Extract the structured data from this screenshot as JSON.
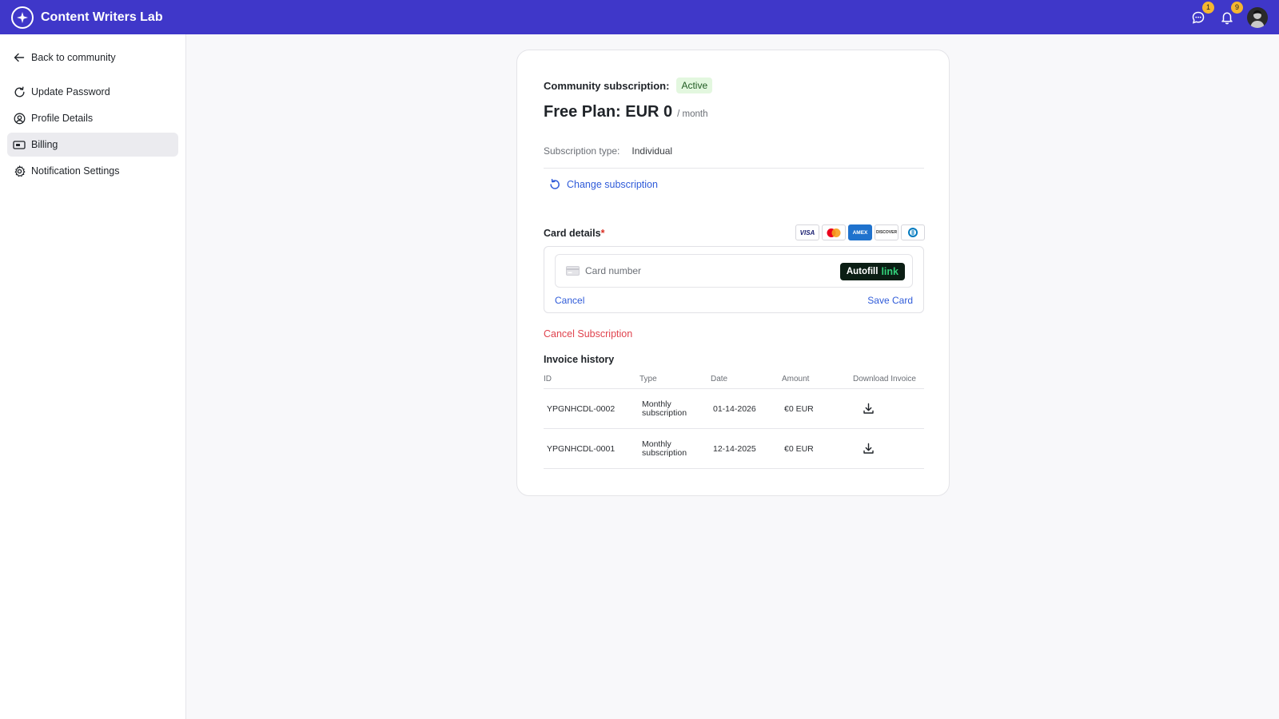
{
  "header": {
    "brand": "Content Writers Lab",
    "messages_badge": "1",
    "notifications_badge": "9"
  },
  "sidebar": {
    "back": "Back to community",
    "items": [
      {
        "label": "Update Password",
        "icon": "refresh-icon"
      },
      {
        "label": "Profile Details",
        "icon": "user-circle-icon"
      },
      {
        "label": "Billing",
        "icon": "billing-icon",
        "active": true
      },
      {
        "label": "Notification Settings",
        "icon": "gear-icon"
      }
    ]
  },
  "subscription": {
    "label": "Community subscription:",
    "status": "Active",
    "plan": "Free Plan: EUR 0",
    "plan_suffix": "/ month",
    "type_label": "Subscription type:",
    "type_value": "Individual",
    "change_label": "Change subscription"
  },
  "card": {
    "label": "Card details",
    "required_mark": "*",
    "brands": [
      "VISA",
      "Mastercard",
      "AMEX",
      "DISCOVER",
      "Diners"
    ],
    "placeholder": "Card number",
    "autofill": "Autofill",
    "autofill_link": "link",
    "cancel": "Cancel",
    "save": "Save Card"
  },
  "cancel_subscription": "Cancel Subscription",
  "invoices": {
    "title": "Invoice history",
    "columns": [
      "ID",
      "Type",
      "Date",
      "Amount",
      "Download Invoice"
    ],
    "rows": [
      {
        "id": "YPGNHCDL-0002",
        "type_line1": "Monthly",
        "type_line2": "subscription",
        "date": "01-14-2026",
        "amount": "€0 EUR"
      },
      {
        "id": "YPGNHCDL-0001",
        "type_line1": "Monthly",
        "type_line2": "subscription",
        "date": "12-14-2025",
        "amount": "€0 EUR"
      }
    ]
  },
  "colors": {
    "header_bg": "#3f37c9",
    "link": "#2f5bd9",
    "danger": "#e0434e",
    "active_badge_bg": "#e3f7df",
    "badge": "#f5b62f"
  }
}
